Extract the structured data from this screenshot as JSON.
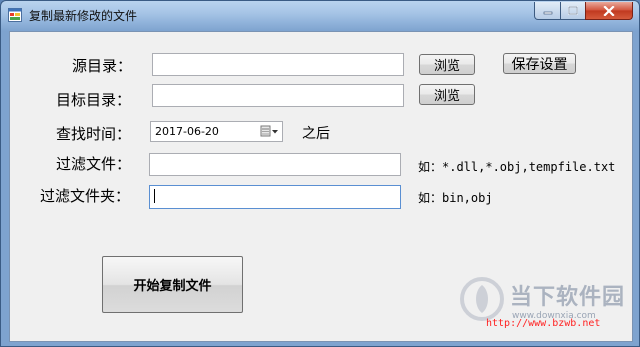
{
  "window": {
    "title": "复制最新修改的文件"
  },
  "form": {
    "source_dir_label": "源目录：",
    "source_dir_value": "",
    "browse_source_label": "浏览",
    "save_settings_label": "保存设置",
    "target_dir_label": "目标目录：",
    "target_dir_value": "",
    "browse_target_label": "浏览",
    "search_time_label": "查找时间：",
    "search_time_value": "2017-06-20",
    "after_label": "之后",
    "filter_files_label": "过滤文件：",
    "filter_files_value": "",
    "filter_files_hint": "如：*.dll,*.obj,tempfile.txt",
    "filter_folders_label": "过滤文件夹：",
    "filter_folders_value": "",
    "filter_folders_hint": "如：bin,obj",
    "start_copy_label": "开始复制文件"
  },
  "watermark": {
    "name": "当下软件园",
    "domain": "www.downxia.com",
    "url": "http://www.bzwb.net"
  },
  "icons": {
    "app": "app-window-icon",
    "minimize": "minimize-icon",
    "maximize": "maximize-icon",
    "close": "close-icon",
    "calendar": "calendar-dropdown-icon",
    "watermark_logo": "watermark-logo-icon"
  },
  "colors": {
    "title_bar": "#a6c4e6",
    "client_bg": "#f0f0f0",
    "close_button": "#c0391f",
    "watermark_url": "#ff2222"
  }
}
